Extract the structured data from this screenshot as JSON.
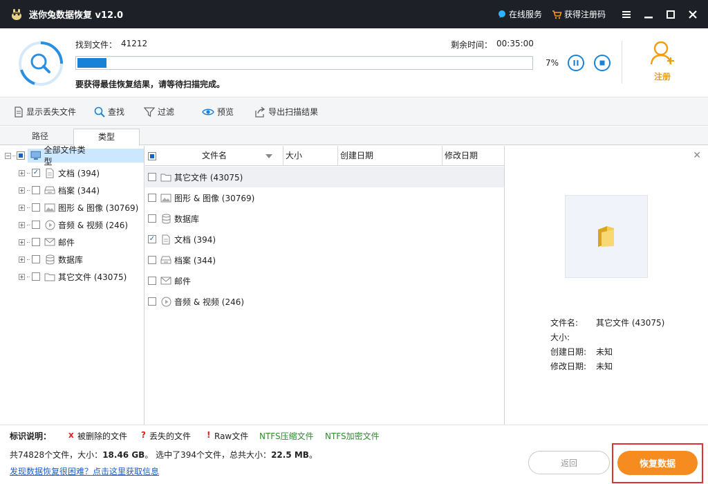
{
  "titlebar": {
    "title": "迷你兔数据恢复 v12.0",
    "online_service": "在线服务",
    "get_code": "获得注册码"
  },
  "scan": {
    "found_label": "找到文件：",
    "found_count": "41212",
    "remaining_label": "剩余时间：",
    "remaining_time": "00:35:00",
    "progress_text": "7%",
    "progress_value": 7,
    "hint": "要获得最佳恢复结果，请等待扫描完成。",
    "register_label": "注册"
  },
  "toolbar": {
    "show_lost": "显示丢失文件",
    "find": "查找",
    "filter": "过滤",
    "preview": "预览",
    "export": "导出扫描结果"
  },
  "tabs": {
    "path": "路径",
    "type": "类型"
  },
  "tree": {
    "root": "全部文件类型",
    "items": [
      {
        "label": "文档 (394)",
        "icon": "document-icon",
        "checked": true
      },
      {
        "label": "档案 (344)",
        "icon": "archive-icon",
        "checked": false
      },
      {
        "label": "图形 & 图像 (30769)",
        "icon": "image-icon",
        "checked": false
      },
      {
        "label": "音频 & 视频 (246)",
        "icon": "media-icon",
        "checked": false
      },
      {
        "label": "邮件",
        "icon": "mail-icon",
        "checked": false
      },
      {
        "label": "数据库",
        "icon": "database-icon",
        "checked": false
      },
      {
        "label": "其它文件 (43075)",
        "icon": "folder-icon",
        "checked": false
      }
    ]
  },
  "filelist": {
    "columns": {
      "name": "文件名",
      "size": "大小",
      "created": "创建日期",
      "modified": "修改日期"
    },
    "rows": [
      {
        "label": "其它文件 (43075)",
        "icon": "folder-icon",
        "checked": false
      },
      {
        "label": "图形 & 图像 (30769)",
        "icon": "image-icon",
        "checked": false
      },
      {
        "label": "数据库",
        "icon": "database-icon",
        "checked": false
      },
      {
        "label": "文档 (394)",
        "icon": "document-icon",
        "checked": true
      },
      {
        "label": "档案 (344)",
        "icon": "archive-icon",
        "checked": false
      },
      {
        "label": "邮件",
        "icon": "mail-icon",
        "checked": false
      },
      {
        "label": "音频 & 视频 (246)",
        "icon": "media-icon",
        "checked": false
      }
    ]
  },
  "preview": {
    "name_label": "文件名:",
    "name_value": "其它文件 (43075)",
    "size_label": "大小:",
    "size_value": "",
    "created_label": "创建日期:",
    "created_value": "未知",
    "modified_label": "修改日期:",
    "modified_value": "未知"
  },
  "legend": {
    "title": "标识说明：",
    "deleted": "被删除的文件",
    "lost": "丢失的文件",
    "raw": "Raw文件",
    "ntfs_compressed": "NTFS压缩文件",
    "ntfs_encrypted": "NTFS加密文件"
  },
  "summary": {
    "p1": "共74828个文件，大小：",
    "total_size": "18.46 GB",
    "p2": "。 选中了394个文件，总共大小：",
    "selected_size": "22.5 MB",
    "p3": "。"
  },
  "help_link": "发现数据恢复很困难？点击这里获取信息",
  "buttons": {
    "back": "返回",
    "recover": "恢复数据"
  },
  "colors": {
    "accent": "#1a82d6",
    "orange": "#f68b1f",
    "titlebar": "#1e2027",
    "ntfs_green": "#2e8b2e"
  }
}
